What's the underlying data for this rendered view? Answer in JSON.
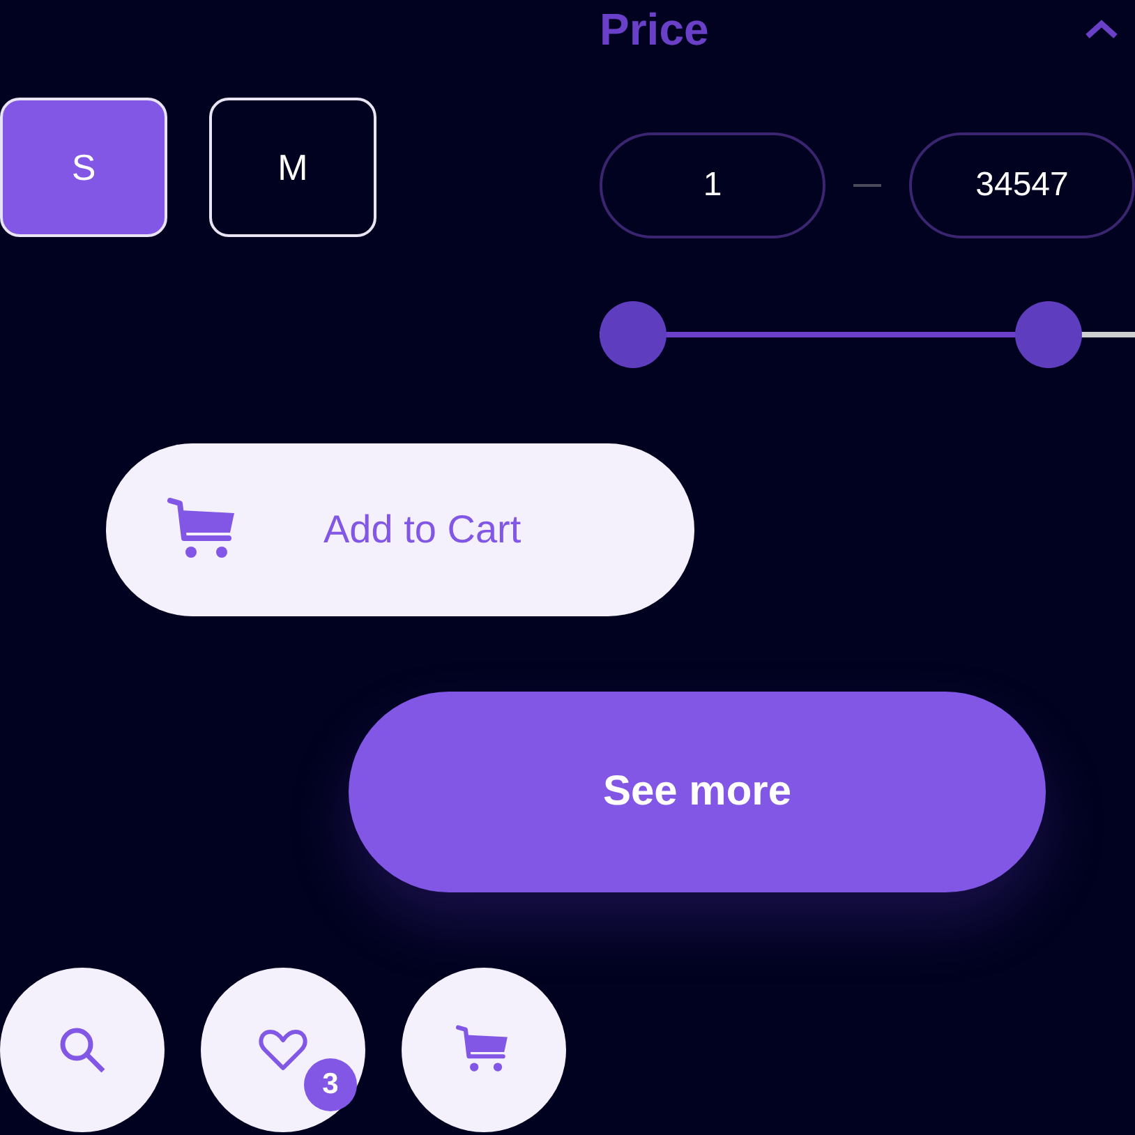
{
  "sizes": [
    {
      "label": "S",
      "selected": true
    },
    {
      "label": "M",
      "selected": false
    }
  ],
  "price": {
    "title": "Price",
    "expanded": true,
    "min": "1",
    "max": "34547",
    "thumbs": [
      {
        "level": 0
      },
      {
        "level": 0.87
      }
    ]
  },
  "add_to_cart": {
    "label": "Add to Cart"
  },
  "see_more": {
    "label": "See more"
  },
  "icon_buttons": [
    {
      "kind": "search"
    },
    {
      "kind": "heart",
      "badge": "3"
    },
    {
      "kind": "cart"
    }
  ]
}
